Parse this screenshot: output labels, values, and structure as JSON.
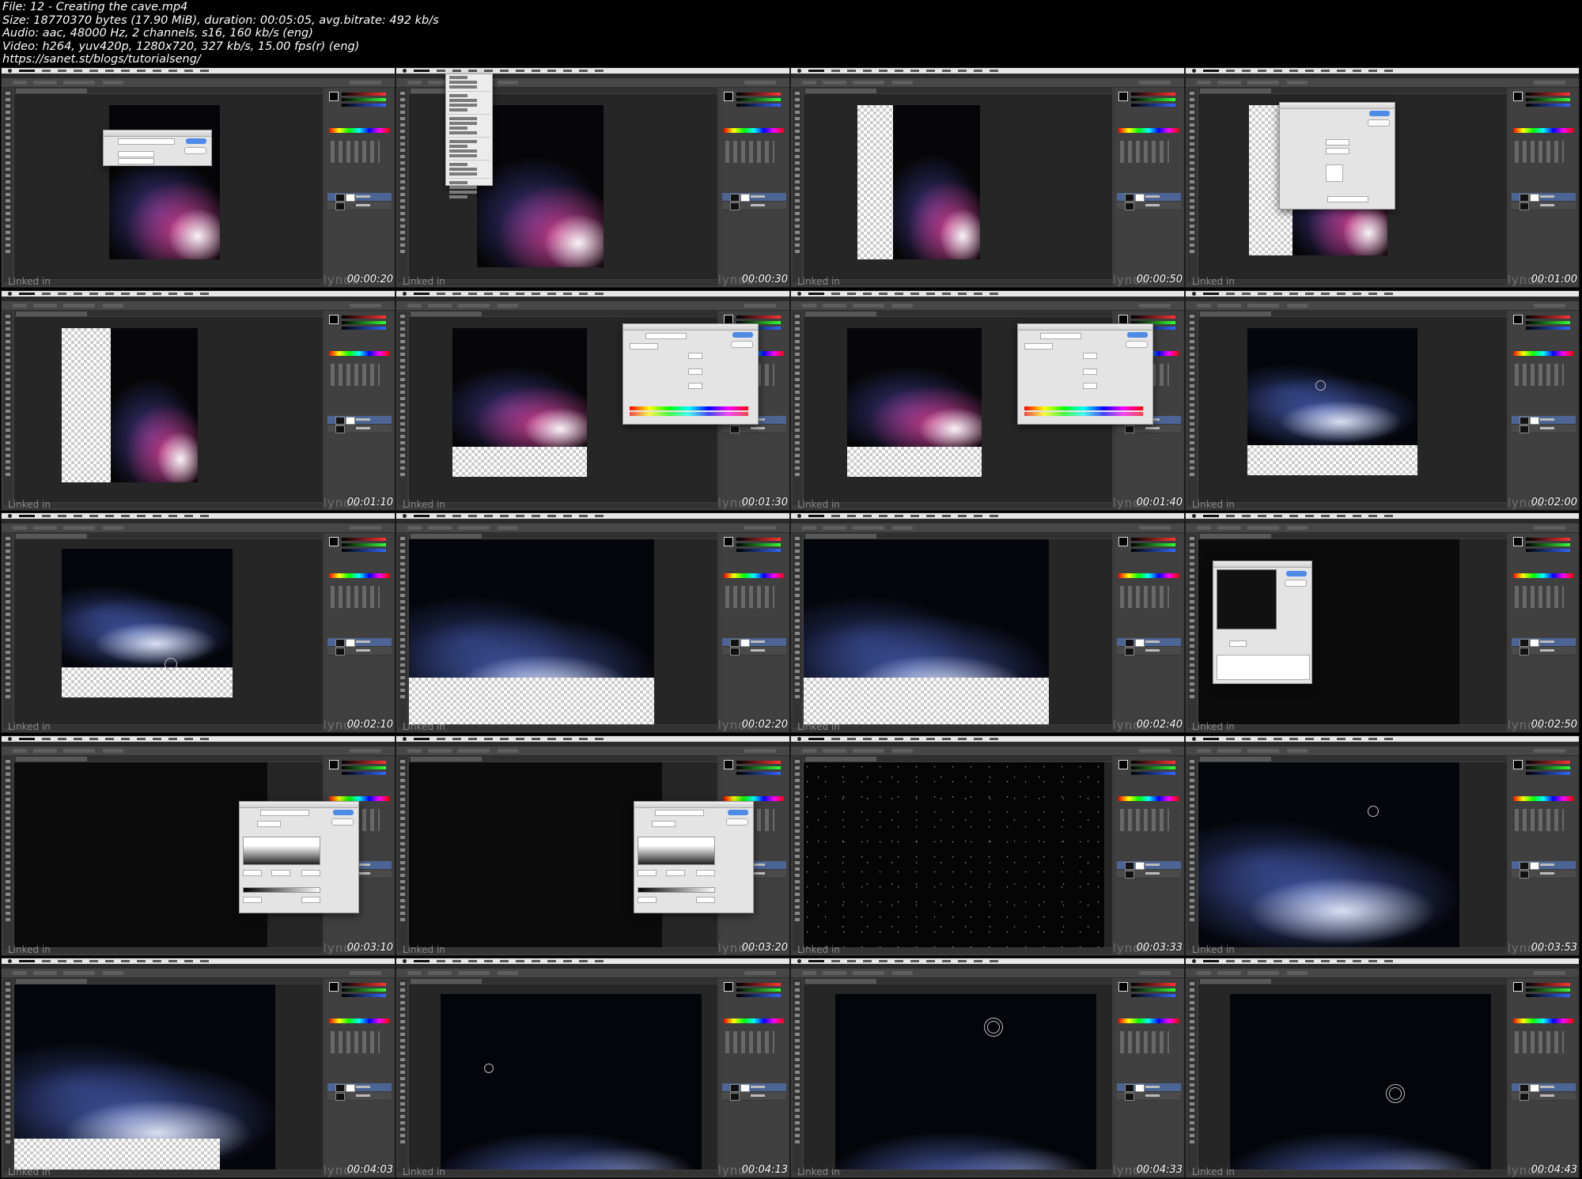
{
  "header": {
    "lines": [
      "File: 12 - Creating the cave.mp4",
      "Size: 18770370 bytes (17.90 MiB), duration: 00:05:05, avg.bitrate: 492 kb/s",
      "Audio: aac, 48000 Hz, 2 channels, s16, 160 kb/s (eng)",
      "Video: h264, yuv420p, 1280x720, 327 kb/s, 15.00 fps(r) (eng)",
      "https://sanet.st/blogs/tutorialseng/"
    ]
  },
  "watermark": "lynda",
  "branding": "Linked in",
  "frames": [
    {
      "timestamp": "00:00:20",
      "scene": "new-layer-dialog"
    },
    {
      "timestamp": "00:00:30",
      "scene": "image-menu-open"
    },
    {
      "timestamp": "00:00:50",
      "scene": "canvas-extended-left"
    },
    {
      "timestamp": "00:01:00",
      "scene": "canvas-size-dialog"
    },
    {
      "timestamp": "00:01:10",
      "scene": "transform-canvas"
    },
    {
      "timestamp": "00:01:30",
      "scene": "hue-saturation-default"
    },
    {
      "timestamp": "00:01:40",
      "scene": "hue-saturation-colorize"
    },
    {
      "timestamp": "00:02:00",
      "scene": "blue-cave-brush"
    },
    {
      "timestamp": "00:02:10",
      "scene": "blue-cave-mask"
    },
    {
      "timestamp": "00:02:20",
      "scene": "blue-cave-zoom"
    },
    {
      "timestamp": "00:02:40",
      "scene": "blue-cave-zoom-2"
    },
    {
      "timestamp": "00:02:50",
      "scene": "add-noise-dialog"
    },
    {
      "timestamp": "00:03:10",
      "scene": "levels-dialog"
    },
    {
      "timestamp": "00:03:20",
      "scene": "levels-dialog-2"
    },
    {
      "timestamp": "00:03:33",
      "scene": "starfield"
    },
    {
      "timestamp": "00:03:53",
      "scene": "blue-cave-circle"
    },
    {
      "timestamp": "00:04:03",
      "scene": "blue-cave-checker-bottom"
    },
    {
      "timestamp": "00:04:13",
      "scene": "blue-low-brush"
    },
    {
      "timestamp": "00:04:33",
      "scene": "blue-low-ring-top"
    },
    {
      "timestamp": "00:04:43",
      "scene": "blue-low-ring-bottom"
    }
  ]
}
